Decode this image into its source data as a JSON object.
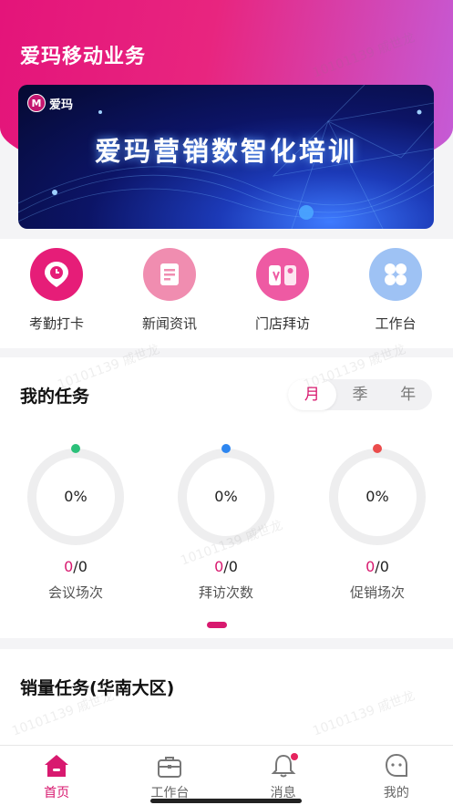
{
  "header": {
    "title": "爱玛移动业务"
  },
  "banner": {
    "logo_text": "爱玛",
    "title": "爱玛营销数智化培训"
  },
  "quick_actions": [
    {
      "label": "考勤打卡",
      "icon": "location-clock-icon",
      "color": "#e61d78"
    },
    {
      "label": "新闻资讯",
      "icon": "document-icon",
      "color": "#f08db0"
    },
    {
      "label": "门店拜访",
      "icon": "store-visit-icon",
      "color": "#ee5aa3"
    },
    {
      "label": "工作台",
      "icon": "grid-icon",
      "color": "#9ec2f4"
    }
  ],
  "tasks": {
    "title": "我的任务",
    "periods": [
      "月",
      "季",
      "年"
    ],
    "selected_period": "月",
    "items": [
      {
        "percent": "0%",
        "done": "0",
        "total": "/0",
        "label": "会议场次",
        "dot_color": "#2cc07a"
      },
      {
        "percent": "0%",
        "done": "0",
        "total": "/0",
        "label": "拜访次数",
        "dot_color": "#2d86f0"
      },
      {
        "percent": "0%",
        "done": "0",
        "total": "/0",
        "label": "促销场次",
        "dot_color": "#eb4c4c"
      }
    ]
  },
  "sales": {
    "title": "销量任务(华南大区)"
  },
  "tabbar": [
    {
      "label": "首页",
      "icon": "home-icon",
      "active": true
    },
    {
      "label": "工作台",
      "icon": "briefcase-icon",
      "active": false
    },
    {
      "label": "消息",
      "icon": "bell-icon",
      "active": false,
      "badge": true
    },
    {
      "label": "我的",
      "icon": "profile-face-icon",
      "active": false
    }
  ],
  "watermark": "10101139 戚世龙",
  "colors": {
    "brand": "#d8196f",
    "header_start": "#e4147a",
    "header_end": "#c45cd8"
  }
}
